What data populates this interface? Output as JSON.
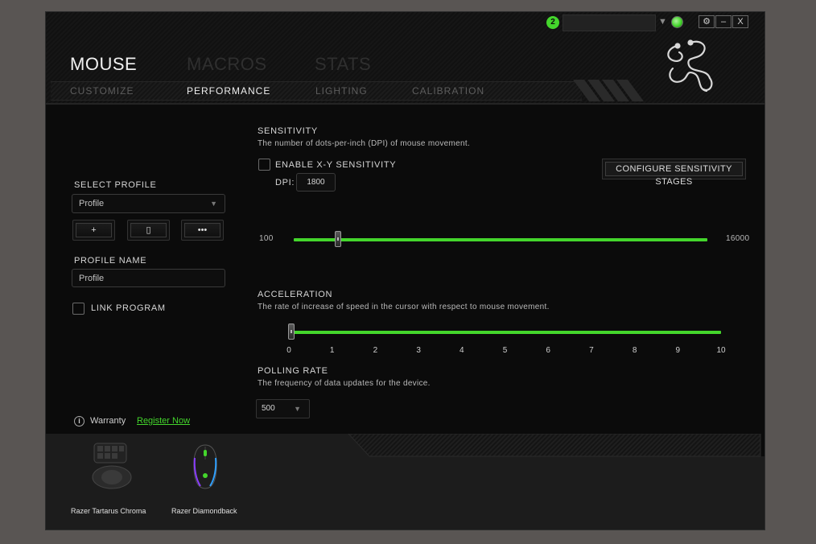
{
  "header": {
    "notification_count": "2",
    "window_buttons": {
      "settings": "⚙",
      "minimize": "–",
      "close": "X"
    }
  },
  "tabs": {
    "main": [
      "MOUSE",
      "MACROS",
      "STATS"
    ],
    "sub": [
      "CUSTOMIZE",
      "PERFORMANCE",
      "LIGHTING",
      "CALIBRATION"
    ]
  },
  "left": {
    "select_profile_label": "SELECT PROFILE",
    "profile_value": "Profile",
    "add_btn": "+",
    "delete_btn": "▯",
    "more_btn": "•••",
    "profile_name_label": "PROFILE NAME",
    "profile_name_value": "Profile",
    "link_program_label": "LINK PROGRAM",
    "warranty_icon": "i",
    "warranty_label": "Warranty",
    "register_link": "Register Now"
  },
  "sensitivity": {
    "title": "SENSITIVITY",
    "description": "The number of dots-per-inch (DPI) of mouse movement.",
    "xy_label": "ENABLE X-Y SENSITIVITY",
    "dpi_label": "DPI:",
    "dpi_value": "1800",
    "configure_btn": "CONFIGURE SENSITIVITY STAGES",
    "min_label": "100",
    "max_label": "16000",
    "min": 100,
    "max": 16000,
    "value": 1800
  },
  "acceleration": {
    "title": "ACCELERATION",
    "description": "The rate of increase of speed in the cursor with respect to mouse movement.",
    "ticks": [
      "0",
      "1",
      "2",
      "3",
      "4",
      "5",
      "6",
      "7",
      "8",
      "9",
      "10"
    ],
    "value": 0
  },
  "polling": {
    "title": "POLLING RATE",
    "description": "The frequency of data updates for the device.",
    "value": "500"
  },
  "devices": [
    "Razer Tartarus Chroma",
    "Razer Diamondback"
  ],
  "colors": {
    "accent": "#44d62c",
    "background": "#0b0b0b",
    "desktop": "#595553"
  }
}
